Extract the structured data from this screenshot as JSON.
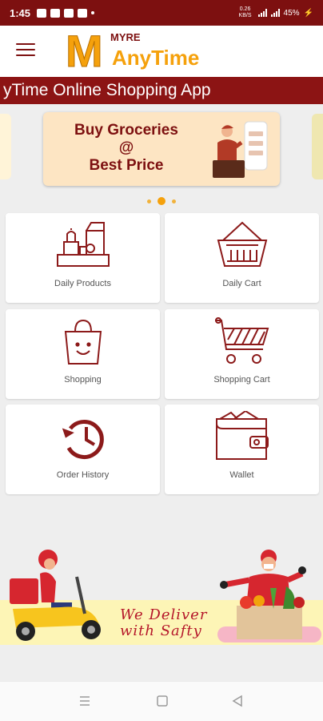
{
  "status_bar": {
    "time": "1:45",
    "data_speed": "0.26 KB/S",
    "battery": "45%"
  },
  "header": {
    "logo_initial": "M",
    "logo_top": "MYRE",
    "logo_bottom": "AnyTime"
  },
  "marquee": {
    "text": "yTime Online Shopping App"
  },
  "banner": {
    "line1": "Buy Groceries",
    "line2": "@",
    "line3": "Best Price",
    "slide_count": 3,
    "active_slide": 2
  },
  "tiles": [
    {
      "label": "Daily Products",
      "icon": "grocery-products-icon"
    },
    {
      "label": "Daily Cart",
      "icon": "basket-icon"
    },
    {
      "label": "Shopping",
      "icon": "shopping-bag-icon"
    },
    {
      "label": "Shopping Cart",
      "icon": "shopping-cart-icon"
    },
    {
      "label": "Order History",
      "icon": "history-icon"
    },
    {
      "label": "Wallet",
      "icon": "wallet-icon"
    }
  ],
  "delivery": {
    "line1": "We Deliver",
    "line2": "with Safty"
  },
  "colors": {
    "brand_maroon": "#7d1010",
    "brand_orange": "#f5a10c",
    "background": "#eeeeee"
  }
}
